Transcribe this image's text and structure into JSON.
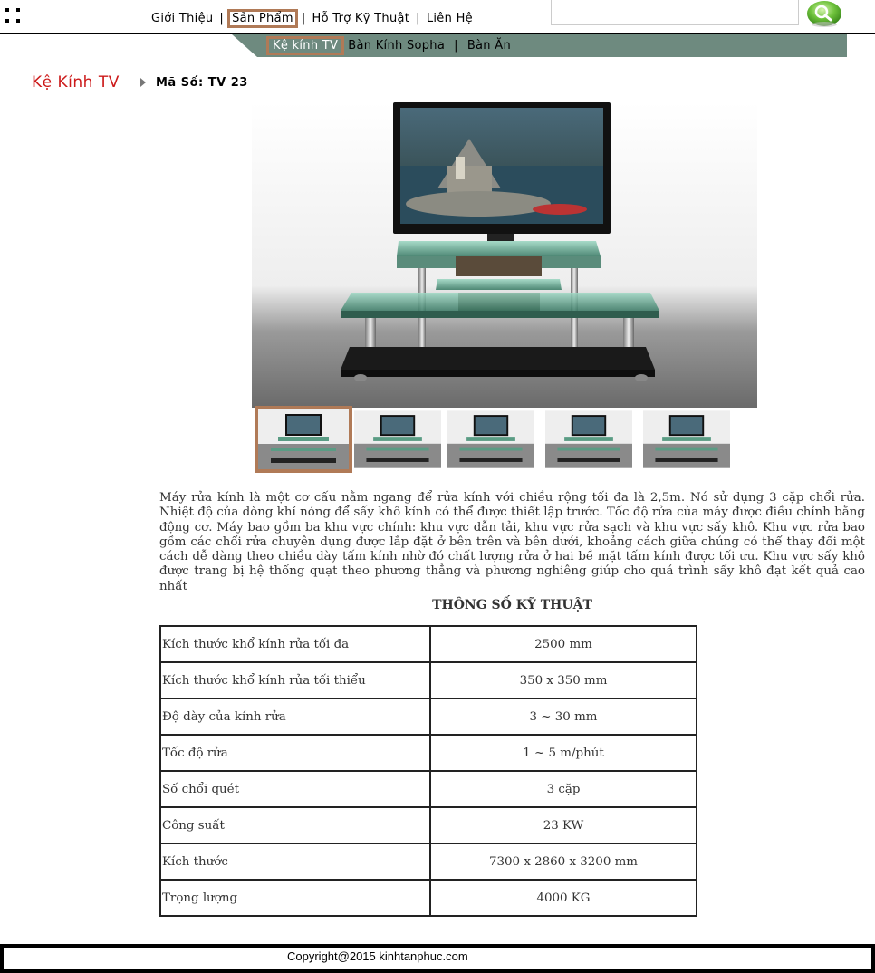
{
  "nav": {
    "items": [
      {
        "label": "Giới Thiệu",
        "active": false
      },
      {
        "label": "Sản Phẩm",
        "active": true
      },
      {
        "label": "Hỗ Trợ Kỹ Thuật",
        "active": false
      },
      {
        "label": "Liên Hệ",
        "active": false
      }
    ],
    "separator": "|"
  },
  "search": {
    "placeholder": "",
    "button_icon": "search-magnifier-icon"
  },
  "subnav": {
    "items": [
      {
        "label": "Kệ kính TV",
        "active": true
      },
      {
        "label": "Bàn Kính Sopha",
        "active": false
      },
      {
        "label": "Bàn Ăn",
        "active": false
      }
    ]
  },
  "breadcrumb": {
    "category": "Kệ Kính TV",
    "code": "Mã Số: TV 23"
  },
  "product": {
    "image_icon": "tv-stand-photo",
    "thumbnails": [
      "tv-stand-thumb-1",
      "tv-stand-thumb-2",
      "tv-stand-thumb-3",
      "tv-stand-thumb-4",
      "tv-stand-thumb-5"
    ],
    "description": "Máy rửa kính là một cơ cấu nằm ngang để rửa kính với chiều rộng tối đa là 2,5m. Nó sử dụng 3 cặp chổi rửa. Nhiệt độ của dòng khí nóng để sấy khô kính có thể được thiết lập trước. Tốc độ rửa của máy được điều chỉnh bằng động cơ. Máy bao gồm ba khu vực chính: khu vực dẫn tải, khu vực rửa sạch và khu vực sấy khô. Khu vực rửa bao gồm các chổi rửa chuyên dụng được lắp đặt ở bên trên và bên dưới, khoảng cách giữa chúng có thể thay đổi một cách dễ dàng theo chiều dày tấm kính nhờ đó chất lượng rửa ở hai bề mặt tấm kính được tối ưu. Khu vực sấy khô được trang bị hệ thống quạt theo phương thẳng và phương nghiêng giúp cho quá trình sấy khô đạt kết quả cao nhất"
  },
  "specs": {
    "title": "THÔNG SỐ KỸ THUẬT",
    "rows": [
      {
        "key": "Kích thước khổ kính rửa tối đa",
        "value": "2500 mm"
      },
      {
        "key": "Kích thước khổ kính rửa tối thiểu",
        "value": "350 x 350 mm"
      },
      {
        "key": "Độ dày của kính rửa",
        "value": "3 ~ 30 mm"
      },
      {
        "key": "Tốc độ rửa",
        "value": "1 ~ 5 m/phút"
      },
      {
        "key": "Số chổi quét",
        "value": "3 cặp"
      },
      {
        "key": "Công suất",
        "value": "23 KW"
      },
      {
        "key": "Kích thước",
        "value": "7300 x 2860 x 3200 mm"
      },
      {
        "key": "Trọng lượng",
        "value": "4000 KG"
      }
    ]
  },
  "footer": {
    "copyright": "Copyright@2015 kinhtanphuc.com"
  },
  "colors": {
    "accent_border": "#b07a57",
    "subnav_bg": "#6e8a7f",
    "category_red": "#cc1a1a"
  }
}
